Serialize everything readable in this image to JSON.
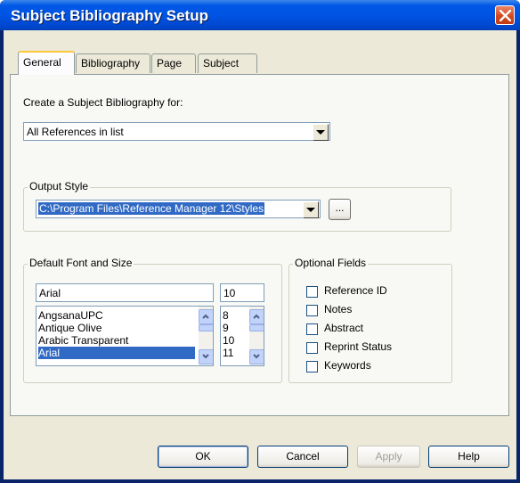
{
  "window": {
    "title": "Subject Bibliography Setup"
  },
  "tabs": [
    {
      "label": "General"
    },
    {
      "label": "Bibliography"
    },
    {
      "label": "Page"
    },
    {
      "label": "Subject"
    }
  ],
  "general": {
    "create_label": "Create a Subject Bibliography for:",
    "create_value": "All References in list",
    "output_style": {
      "label": "Output Style",
      "value": "C:\\Program Files\\Reference Manager 12\\Styles",
      "browse_label": "..."
    },
    "font": {
      "label": "Default Font and Size",
      "font_value": "Arial",
      "size_value": "10",
      "fonts": [
        "AngsanaUPC",
        "Antique Olive",
        "Arabic Transparent",
        "Arial"
      ],
      "selected_font": "Arial",
      "sizes": [
        "8",
        "9",
        "10",
        "11"
      ],
      "selected_size": "11"
    },
    "optional_fields": {
      "label": "Optional Fields",
      "items": [
        {
          "label": "Reference ID",
          "checked": false
        },
        {
          "label": "Notes",
          "checked": false
        },
        {
          "label": "Abstract",
          "checked": false
        },
        {
          "label": "Reprint Status",
          "checked": false
        },
        {
          "label": "Keywords",
          "checked": false
        }
      ]
    }
  },
  "buttons": {
    "ok": "OK",
    "cancel": "Cancel",
    "apply": "Apply",
    "help": "Help"
  },
  "colors": {
    "titlebar": "#0054e3",
    "face": "#ece9d8",
    "selection": "#316ac5",
    "close": "#d6491e"
  }
}
